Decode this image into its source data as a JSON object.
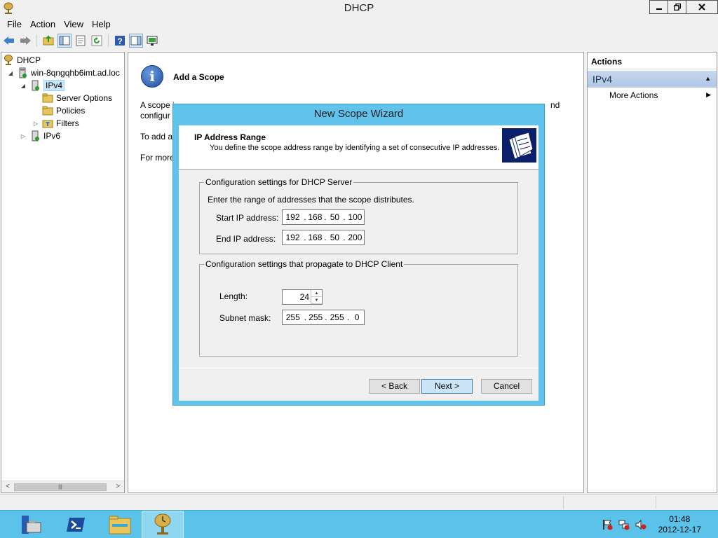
{
  "window": {
    "title": "DHCP"
  },
  "menu": [
    "File",
    "Action",
    "View",
    "Help"
  ],
  "tree": {
    "root": "DHCP",
    "server": "win-8qngqhb6imt.ad.loc",
    "ipv4": "IPv4",
    "server_options": "Server Options",
    "policies": "Policies",
    "filters": "Filters",
    "ipv6": "IPv6"
  },
  "center": {
    "heading": "Add a Scope",
    "line1a": "A scope i",
    "line1b": "nd",
    "line2": "configur",
    "line3": "To add a",
    "line4": "For more"
  },
  "actions": {
    "header": "Actions",
    "section": "IPv4",
    "more": "More Actions"
  },
  "wizard": {
    "title": "New Scope Wizard",
    "header_title": "IP Address Range",
    "header_sub": "You define the scope address range by identifying a set of consecutive IP addresses.",
    "group1_legend": "Configuration settings for DHCP Server",
    "group1_desc": "Enter the range of addresses that the scope distributes.",
    "start_label": "Start IP address:",
    "start_ip": [
      "192",
      "168",
      "50",
      "100"
    ],
    "end_label": "End IP address:",
    "end_ip": [
      "192",
      "168",
      "50",
      "200"
    ],
    "group2_legend": "Configuration settings that propagate to DHCP Client",
    "length_label": "Length:",
    "length_value": "24",
    "mask_label": "Subnet mask:",
    "mask": [
      "255",
      "255",
      "255",
      "0"
    ],
    "back": "< Back",
    "next": "Next >",
    "cancel": "Cancel"
  },
  "taskbar": {
    "time": "01:48",
    "date": "2012-12-17"
  },
  "colors": {
    "wizard_frame": "#5fc3ec",
    "taskbar": "#5bc2ea",
    "actions_section": "#b0c6e3"
  }
}
